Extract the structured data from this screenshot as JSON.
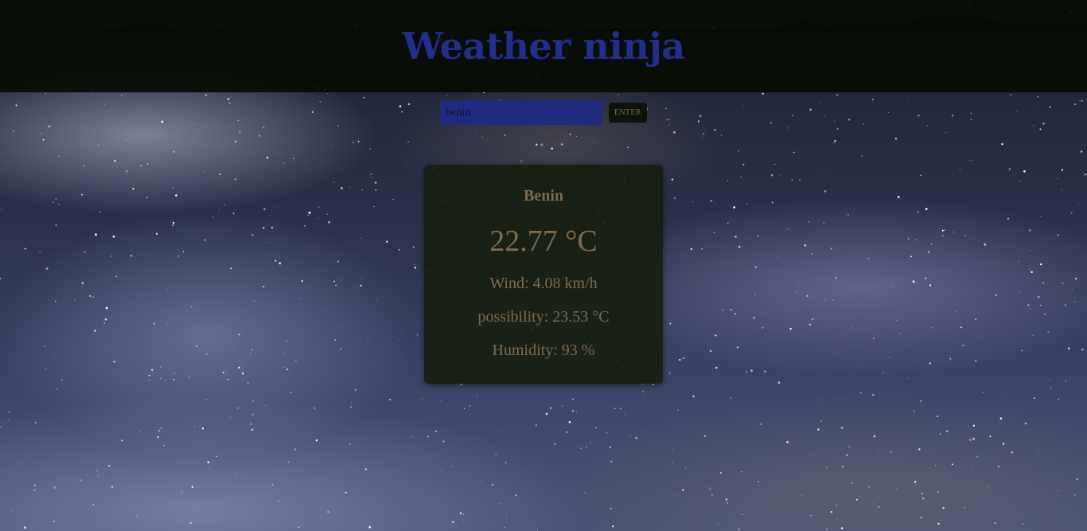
{
  "app": {
    "title": "Weather ninja"
  },
  "search": {
    "value": "benin",
    "enter_label": "ENTER"
  },
  "weather": {
    "city": "Benin",
    "temperature": "22.77 °C",
    "wind": "Wind: 4.08 km/h",
    "possibility": "possibility: 23.53 °C",
    "humidity": "Humidity: 93 %"
  },
  "colors": {
    "title": "#232e8c",
    "header_bg": "#080c04",
    "input_bg": "#1f2b80",
    "card_text": "#7e6a4c"
  }
}
